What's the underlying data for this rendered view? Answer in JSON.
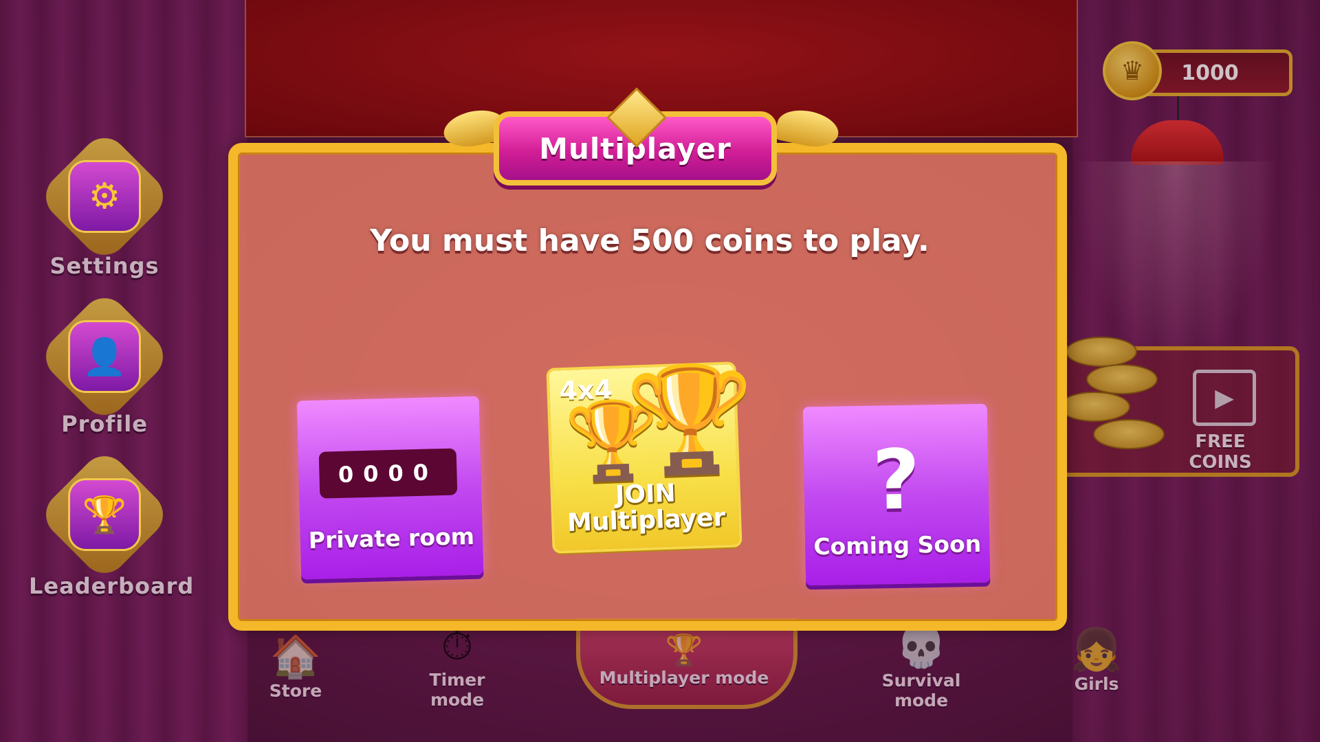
{
  "hud": {
    "coins": "1000",
    "crown_icon": "crown-icon"
  },
  "side_menu": [
    {
      "label": "Settings",
      "icon": "gear-icon",
      "glyph": "⚙"
    },
    {
      "label": "Profile",
      "icon": "user-icon",
      "glyph": "👤"
    },
    {
      "label": "Leaderboard",
      "icon": "trophy-icon",
      "glyph": "🏆"
    }
  ],
  "free_coins": {
    "label": "FREE COINS",
    "icon": "video-icon",
    "glyph": "▶"
  },
  "bottom_nav": [
    {
      "label": "Store",
      "icon": "store-icon",
      "glyph": "🏠"
    },
    {
      "label": "Timer mode",
      "icon": "stopwatch-icon",
      "glyph": "⏱"
    },
    {
      "label": "Multiplayer mode",
      "icon": "trophies-icon",
      "glyph": "🏆"
    },
    {
      "label": "Survival mode",
      "icon": "skull-icon",
      "glyph": "💀"
    },
    {
      "label": "Girls",
      "icon": "girl-avatar-icon",
      "glyph": "👧"
    }
  ],
  "modal": {
    "title": "Multiplayer",
    "message": "You must have 500 coins to play.",
    "cards": {
      "private": {
        "label": "Private room",
        "pin": "0000"
      },
      "join": {
        "size": "4x4",
        "label_line1": "JOIN",
        "label_line2": "Multiplayer"
      },
      "soon": {
        "label": "Coming Soon",
        "glyph": "?"
      }
    }
  }
}
